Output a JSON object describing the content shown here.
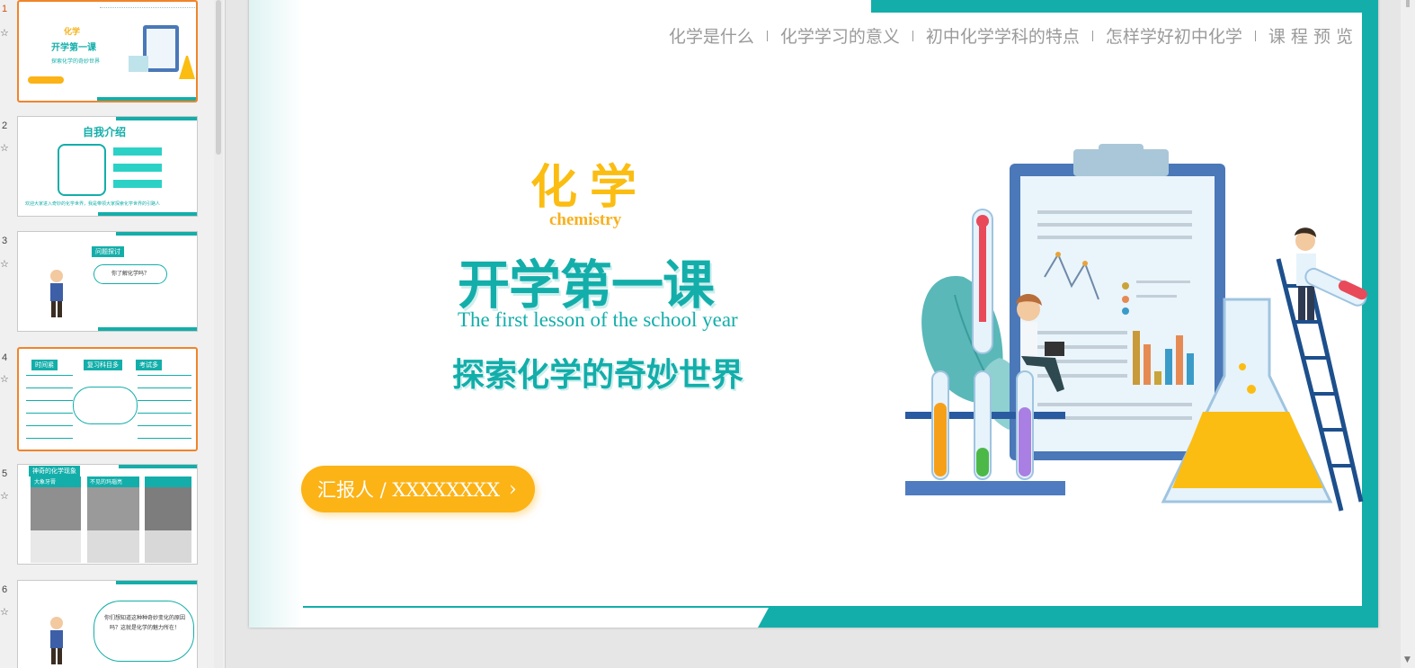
{
  "thumbnails": [
    {
      "num": "1",
      "title": "化学",
      "sub": "开学第一课",
      "desc": "探索化学的奇妙世界",
      "selected": true
    },
    {
      "num": "2",
      "title": "自我介绍",
      "sub": "",
      "desc": "欢迎大家进入奇妙的化学世界，我是带领大家探索化学世界的引路人",
      "selected": false
    },
    {
      "num": "3",
      "title": "问题探讨",
      "sub": "",
      "desc": "你了解化学吗？",
      "selected": false
    },
    {
      "num": "4",
      "title": "时间紧",
      "sub": "复习科目多",
      "desc": "考试多",
      "selected": true
    },
    {
      "num": "5",
      "title": "神奇的化学现象",
      "sub": "大象牙膏",
      "desc": "不见的玛瑙亮",
      "selected": false
    },
    {
      "num": "6",
      "title": "",
      "sub": "",
      "desc": "你们想知道这种种奇妙变化的原因吗？这就是化学的魅力所在！",
      "selected": false
    }
  ],
  "slide": {
    "nav": [
      "化学是什么",
      "化学学习的意义",
      "初中化学学科的特点",
      "怎样学好初中化学",
      "课 程 预 览"
    ],
    "title_cn": "化学",
    "title_en": "chemistry",
    "main_cn": "开学第一课",
    "main_en": "The first lesson of the school year",
    "sub_cn": "探索化学的奇妙世界",
    "reporter": "汇报人 / XXXXXXXX",
    "colors": {
      "teal": "#13aeaa",
      "yellow": "#fbbd12"
    }
  }
}
